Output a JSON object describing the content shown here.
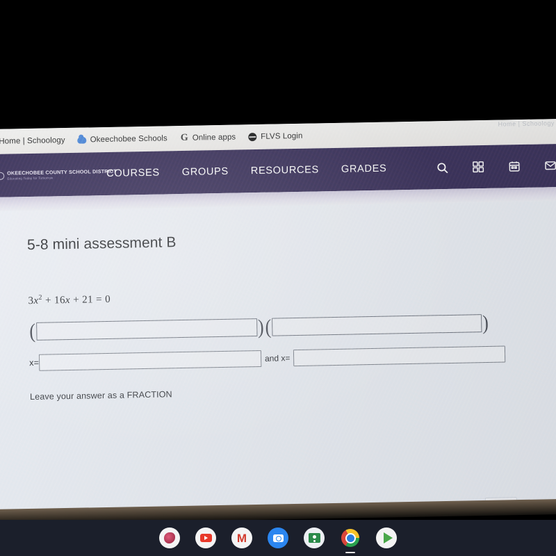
{
  "browser": {
    "bookmarks": [
      {
        "label": "Home | Schoology",
        "icon": "none"
      },
      {
        "label": "Okeechobee Schools",
        "icon": "cloud-icon"
      },
      {
        "label": "Online apps",
        "icon": "google-g-icon"
      },
      {
        "label": "FLVS Login",
        "icon": "globe-icon"
      }
    ],
    "top_cutoff_text": "Home | Schoology"
  },
  "nav": {
    "district_name": "OKEECHOBEE COUNTY SCHOOL DISTRICT",
    "district_tagline": "Educating Today for Tomorrow",
    "links": [
      {
        "label": "COURSES"
      },
      {
        "label": "GROUPS"
      },
      {
        "label": "RESOURCES"
      },
      {
        "label": "GRADES"
      }
    ],
    "icons": [
      {
        "name": "search-icon"
      },
      {
        "name": "apps-grid-icon"
      },
      {
        "name": "calendar-icon"
      },
      {
        "name": "messages-envelope-icon"
      }
    ],
    "bar_color": "#3b3257"
  },
  "assignment": {
    "title": "5-8 mini assessment B",
    "equation": {
      "coefficient_a": "3",
      "var": "x",
      "exponent": "2",
      "plus_1": "+",
      "coefficient_b": "16",
      "plus_2": "+",
      "constant": "21",
      "equals": "=",
      "rhs": "0",
      "plain": "3x^2 + 16x + 21 = 0"
    },
    "factor_row": {
      "open_paren_1": "(",
      "field_1_value": "",
      "field_1_placeholder": "",
      "close_paren_1": ")",
      "open_paren_2": "(",
      "field_2_value": "",
      "field_2_placeholder": "",
      "close_paren_2": ")"
    },
    "solution_row": {
      "label_1": "x=",
      "field_1_value": "",
      "connector": "and x=",
      "field_2_value": ""
    },
    "instruction": "Leave your answer as a FRACTION"
  },
  "shelf": {
    "icons": [
      {
        "name": "pink-app-icon"
      },
      {
        "name": "youtube-icon"
      },
      {
        "name": "gmail-icon"
      },
      {
        "name": "camera-icon"
      },
      {
        "name": "google-classroom-icon"
      },
      {
        "name": "chrome-icon"
      },
      {
        "name": "play-store-icon"
      }
    ]
  }
}
